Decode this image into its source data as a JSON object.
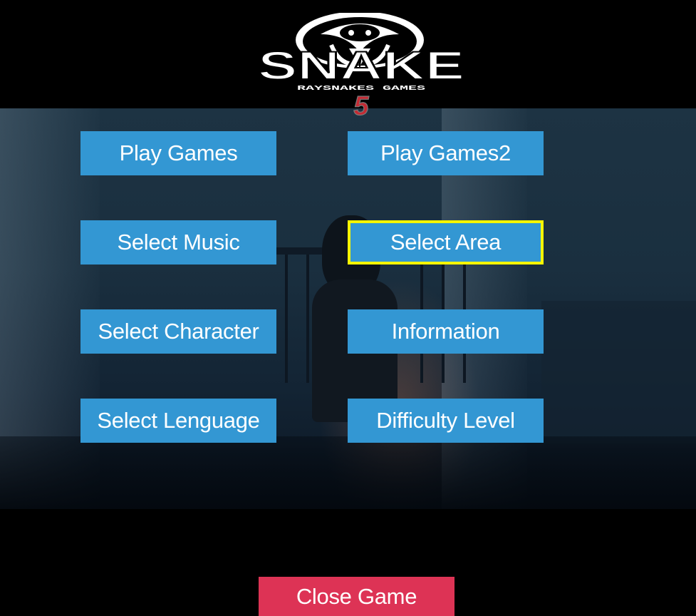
{
  "logo": {
    "title": "SNAKE",
    "subtitle": "RAYSNAKES GAMES",
    "number": "5"
  },
  "menu": {
    "play_games": "Play Games",
    "play_games2": "Play Games2",
    "select_music": "Select Music",
    "select_area": "Select Area",
    "select_character": "Select Character",
    "information": "Information",
    "select_language": "Select Lenguage",
    "difficulty_level": "Difficulty Level",
    "selected_item": "Select Area"
  },
  "close_game": "Close Game",
  "colors": {
    "button": "#3397d3",
    "close_button": "#dd3355",
    "selection_outline": "#f5f500"
  }
}
